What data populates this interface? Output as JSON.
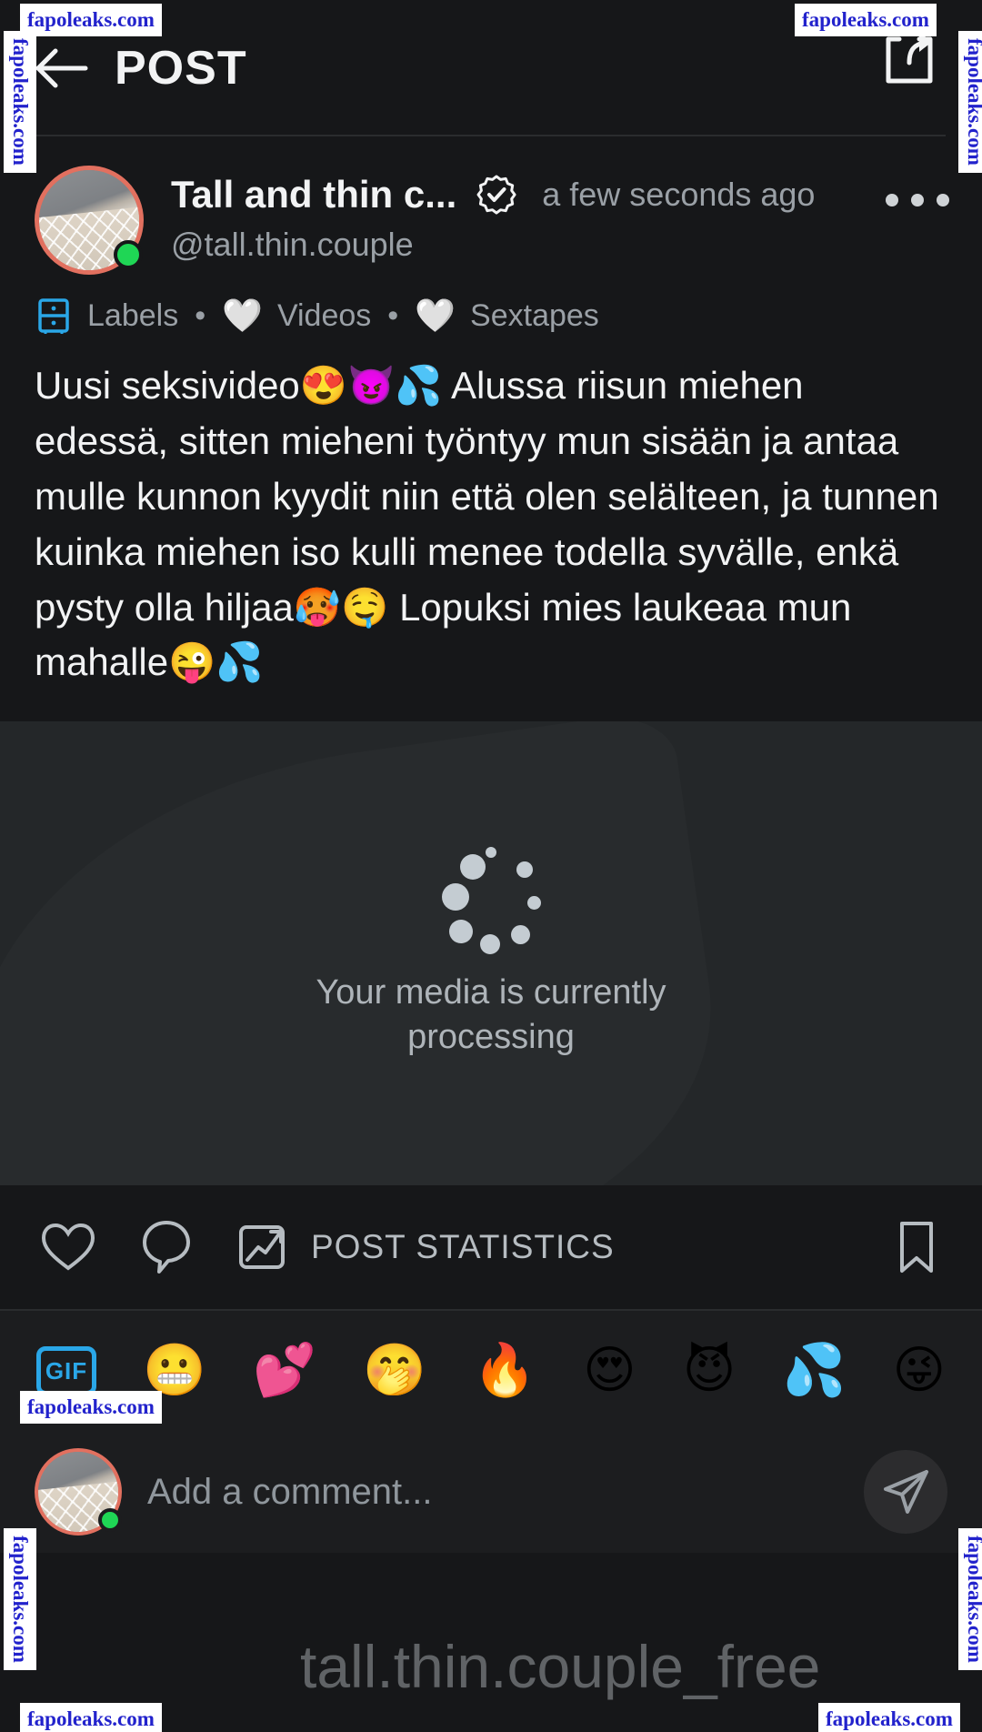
{
  "header": {
    "title": "POST",
    "back_icon": "arrow-left-icon",
    "share_icon": "share-icon"
  },
  "author": {
    "name": "Tall and thin c...",
    "handle": "@tall.thin.couple",
    "timestamp": "a few seconds ago",
    "verified_icon": "verified-badge-icon",
    "more_icon": "more-options-icon",
    "online": true,
    "ring_color": "#e2705f",
    "online_color": "#1fd655"
  },
  "labels": {
    "cabinet_icon": "labels-cabinet-icon",
    "items": [
      {
        "label": "Labels",
        "icon": "labels-cabinet-icon"
      },
      {
        "label": "Videos",
        "icon": "white-heart-emoji",
        "emoji": "🤍"
      },
      {
        "label": "Sextapes",
        "icon": "white-heart-emoji",
        "emoji": "🤍"
      }
    ],
    "separator": "•"
  },
  "post": {
    "body": "Uusi seksivideo😍😈💦 Alussa riisun miehen edessä, sitten mieheni työntyy mun sisään ja antaa mulle kunnon kyydit niin että olen selälteen, ja tunnen kuinka miehen iso kulli menee todella syvälle, enkä pysty olla hiljaa🥵🤤 Lopuksi mies laukeaa mun mahalle😜💦"
  },
  "media": {
    "processing_text": "Your media is currently processing",
    "spinner_icon": "loading-spinner-icon",
    "background_color": "#242729"
  },
  "actions": {
    "like_icon": "heart-icon",
    "comment_icon": "comment-bubble-icon",
    "statistics_icon": "chart-statistics-icon",
    "statistics_label": "POST STATISTICS",
    "bookmark_icon": "bookmark-icon"
  },
  "emoji_bar": {
    "gif_label": "GIF",
    "gif_icon": "gif-button-icon",
    "emojis": [
      {
        "name": "grimacing-face-emoji",
        "char": "😬"
      },
      {
        "name": "two-hearts-emoji",
        "char": "💕"
      },
      {
        "name": "face-with-hand-over-mouth-emoji",
        "char": "🤭"
      },
      {
        "name": "fire-emoji",
        "char": "🔥"
      },
      {
        "name": "smiling-face-with-hearts-eyes-emoji",
        "char": "😍"
      },
      {
        "name": "smiling-face-with-horns-emoji",
        "char": "😈"
      },
      {
        "name": "sweat-droplets-emoji",
        "char": "💦"
      },
      {
        "name": "winking-face-with-tongue-emoji",
        "char": "😜"
      }
    ]
  },
  "comment": {
    "placeholder": "Add a comment...",
    "value": "",
    "send_icon": "send-icon",
    "avatar_icon": "user-avatar"
  },
  "watermarks": {
    "overlay_text": "tall.thin.couple_free",
    "site": "fapoleaks.com"
  }
}
